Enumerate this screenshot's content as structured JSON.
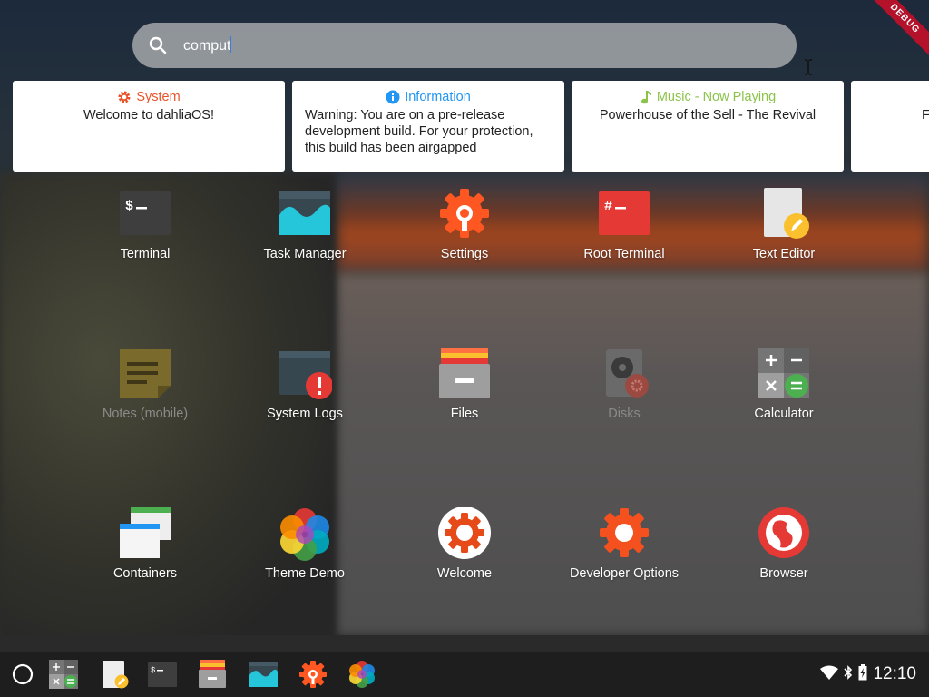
{
  "search": {
    "query": "comput"
  },
  "debug_banner": "DEBUG",
  "cards": [
    {
      "title": "System",
      "title_color": "#e8532a",
      "icon": "gear-icon",
      "body": "Welcome to dahliaOS!"
    },
    {
      "title": "Information",
      "title_color": "#2196f3",
      "icon": "info-icon",
      "body": "Warning: You are on a pre-release development build. For your protection, this build has been airgapped"
    },
    {
      "title": "Music - Now Playing",
      "title_color": "#8bc34a",
      "icon": "music-note-icon",
      "body": "Powerhouse of the Sell - The Revival"
    },
    {
      "title": "",
      "title_color": "#333333",
      "icon": "",
      "body": "F"
    }
  ],
  "apps": [
    {
      "label": "Terminal",
      "icon": "terminal-icon"
    },
    {
      "label": "Task Manager",
      "icon": "task-manager-icon"
    },
    {
      "label": "Settings",
      "icon": "settings-icon"
    },
    {
      "label": "Root Terminal",
      "icon": "root-terminal-icon"
    },
    {
      "label": "Text Editor",
      "icon": "text-editor-icon"
    },
    {
      "label": "Notes (mobile)",
      "icon": "notes-icon"
    },
    {
      "label": "System Logs",
      "icon": "system-logs-icon"
    },
    {
      "label": "Files",
      "icon": "files-icon"
    },
    {
      "label": "Disks",
      "icon": "disks-icon"
    },
    {
      "label": "Calculator",
      "icon": "calculator-icon"
    },
    {
      "label": "Containers",
      "icon": "containers-icon"
    },
    {
      "label": "Theme Demo",
      "icon": "theme-demo-icon"
    },
    {
      "label": "Welcome",
      "icon": "welcome-icon"
    },
    {
      "label": "Developer Options",
      "icon": "developer-options-icon"
    },
    {
      "label": "Browser",
      "icon": "browser-icon"
    }
  ],
  "taskbar": {
    "pinned": [
      "calculator-icon",
      "text-editor-icon",
      "terminal-icon",
      "files-icon",
      "task-manager-icon",
      "settings-icon",
      "theme-demo-icon"
    ],
    "clock": "12:10"
  },
  "colors": {
    "accent_red": "#e53935",
    "accent_orange": "#ff5722",
    "card_bg": "#ffffff"
  }
}
